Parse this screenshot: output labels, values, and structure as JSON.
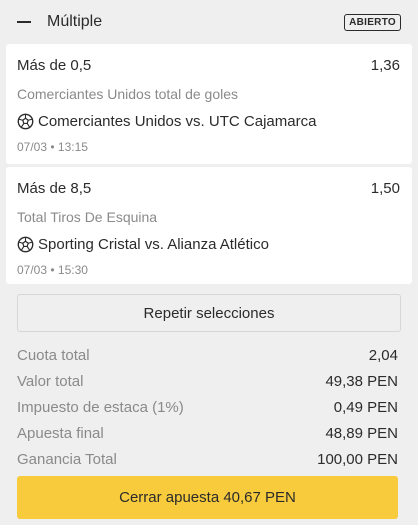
{
  "header": {
    "title": "Múltiple",
    "status": "ABIERTO"
  },
  "selections": [
    {
      "pick": "Más de 0,5",
      "odds": "1,36",
      "market": "Comerciantes Unidos total de goles",
      "event": "Comerciantes Unidos vs. UTC Cajamarca",
      "datetime": "07/03 • 13:15"
    },
    {
      "pick": "Más de 8,5",
      "odds": "1,50",
      "market": "Total Tiros De Esquina",
      "event": "Sporting Cristal vs. Alianza Atlético",
      "datetime": "07/03 • 15:30"
    }
  ],
  "repeat_button": "Repetir selecciones",
  "summary": [
    {
      "label": "Cuota total",
      "value": "2,04"
    },
    {
      "label": "Valor total",
      "value": "49,38 PEN"
    },
    {
      "label": "Impuesto de estaca (1%)",
      "value": "0,49 PEN"
    },
    {
      "label": "Apuesta final",
      "value": "48,89 PEN"
    },
    {
      "label": "Ganancia Total",
      "value": "100,00 PEN"
    }
  ],
  "cashout_button": "Cerrar apuesta 40,67 PEN",
  "colors": {
    "background": "#efefef",
    "accent": "#f7cb3b",
    "muted_text": "#8a8a8a"
  },
  "icons": {
    "collapse": "minus-icon",
    "sport": "soccer-ball-icon"
  }
}
